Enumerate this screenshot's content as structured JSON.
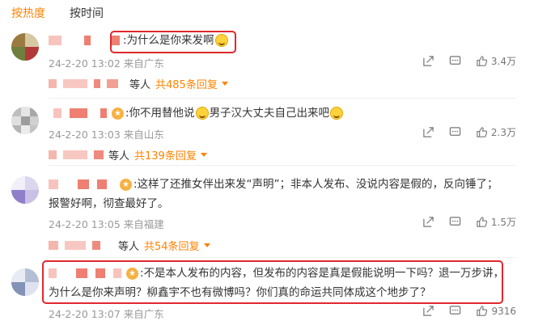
{
  "tabs": {
    "hot": "按热度",
    "time": "按时间"
  },
  "comments": [
    {
      "prefix": ":",
      "text": "为什么是你来发啊",
      "meta": "24-2-20 13:02 来自广东",
      "likes": "3.4万",
      "replies": {
        "people": "等人",
        "count": "共485条回复"
      }
    },
    {
      "prefix": ":",
      "text_a": "你不用替他说",
      "text_b": "男子汉大丈夫自己出来吧",
      "meta": "24-2-20 13:03 来自山东",
      "likes": "2.3万",
      "replies": {
        "people": "等人",
        "count": "共139条回复"
      }
    },
    {
      "prefix": ":",
      "line1": "这样了还推女伴出来发“声明”；非本人发布、没说内容是假的，反向锤了；",
      "line2": "报警好啊，彻查最好了。",
      "meta": "24-2-20 13:05 来自福建",
      "likes": "1.5万",
      "replies": {
        "people": "等人",
        "count": "共54条回复"
      }
    },
    {
      "prefix": ":",
      "line1": "不是本人发布的内容，但发布的内容是真是假能说明一下吗？退一万步讲，",
      "line2": "为什么是你来声明？柳鑫宇不也有微博吗？你们真的命运共同体成这个地步了？",
      "meta": "24-2-20 13:07 来自广东",
      "likes": "9316"
    }
  ],
  "icons": {
    "share": "share-icon",
    "comment": "comment-icon",
    "like": "thumbs-up-icon",
    "badge": "vip-crown-icon",
    "emoji": "laugh-tears-emoji-icon"
  },
  "colors": {
    "accent": "#ff8200",
    "highlight": "#e0282e"
  }
}
